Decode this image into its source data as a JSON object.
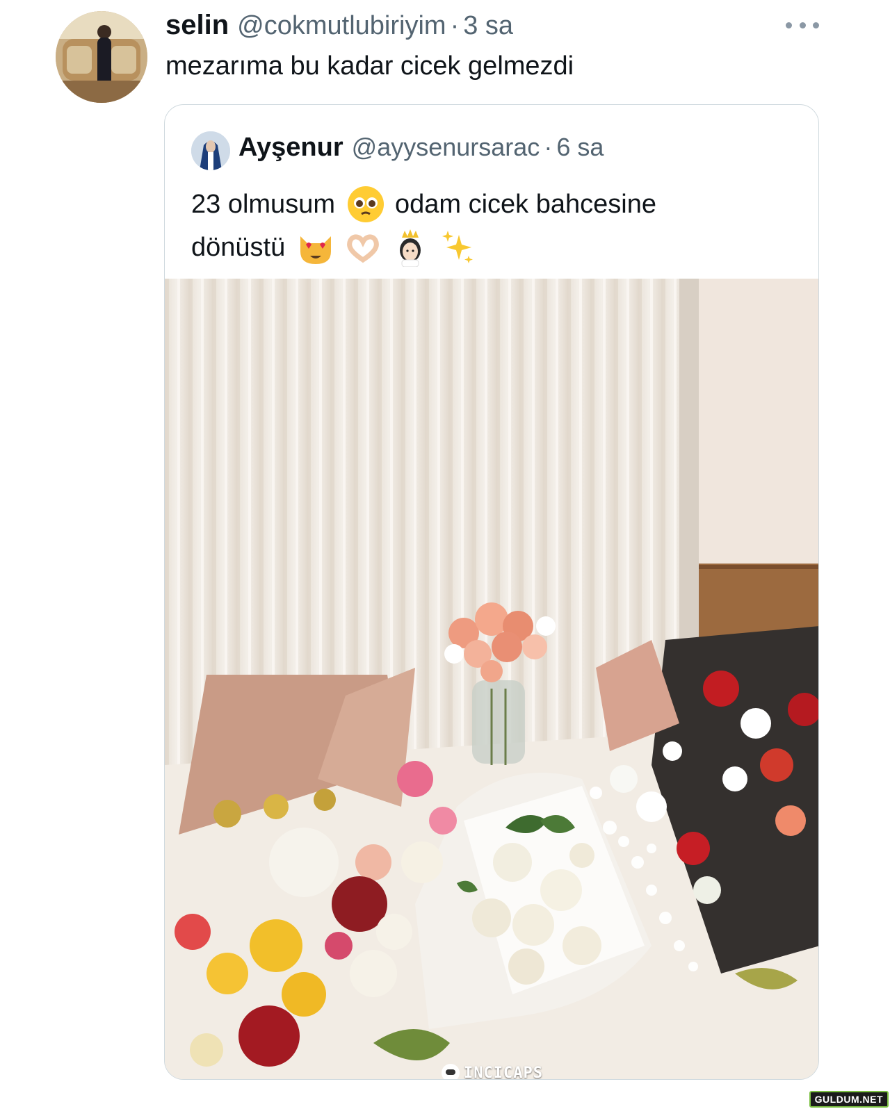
{
  "tweet": {
    "display_name": "selin",
    "handle": "@cokmutlubiriyim",
    "separator": "·",
    "time": "3 sa",
    "text": "mezarıma bu kadar cicek gelmezdi",
    "more_icon": "more-horizontal-icon"
  },
  "quoted_tweet": {
    "display_name": "Ayşenur",
    "handle": "@ayysenursarac",
    "separator": "·",
    "time": "6 sa",
    "text_line1_part1": "23 olmusum",
    "text_line1_part2": "odam cicek bahcesine",
    "text_line2": "dönüstü",
    "emojis": [
      "pleading-face-icon",
      "heart-eyes-cat-icon",
      "heart-hands-icon",
      "princess-icon",
      "sparkles-icon"
    ],
    "image_alt": "bouquets of flowers on a table in front of a white curtain"
  },
  "watermark": "INCICAPS",
  "site_badge": "GULDUM.NET",
  "colors": {
    "text_primary": "#0f1419",
    "text_secondary": "#536471",
    "border": "#cfd9de"
  }
}
